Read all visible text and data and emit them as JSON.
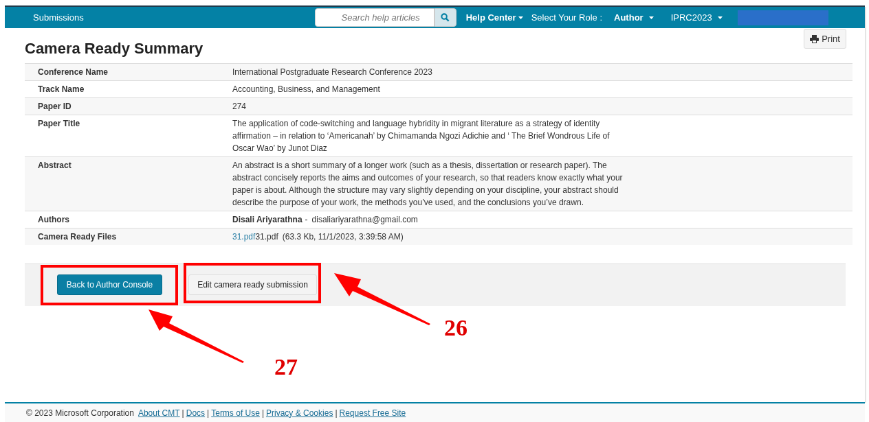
{
  "navbar": {
    "brand": "Submissions",
    "search": {
      "placeholder": "Search help articles"
    },
    "help": "Help Center",
    "role_label": "Select Your Role :",
    "role": "Author",
    "conference": "IPRC2023"
  },
  "page": {
    "title": "Camera Ready Summary",
    "print": "Print"
  },
  "rows": [
    {
      "kind": "text",
      "label": "Conference Name",
      "value": "International Postgraduate Research Conference 2023"
    },
    {
      "kind": "text",
      "label": "Track Name",
      "value": "Accounting, Business, and Management"
    },
    {
      "kind": "text",
      "label": "Paper ID",
      "value": "274"
    },
    {
      "kind": "text",
      "label": "Paper Title",
      "value": "The application of code-switching and language hybridity in migrant literature as a strategy of identity affirmation – in relation to ‘Americanah’ by Chimamanda Ngozi Adichie and ‘ The Brief Wondrous Life of Oscar Wao’ by Junot Diaz"
    },
    {
      "kind": "text",
      "label": "Abstract",
      "value": "An abstract is a short summary of a longer work (such as a thesis, dissertation or research paper). The abstract concisely reports the aims and outcomes of your research, so that readers know exactly what your paper is about. Although the structure may vary slightly depending on your discipline, your abstract should describe the purpose of your work, the methods you’ve used, and the conclusions you’ve drawn."
    },
    {
      "kind": "author",
      "label": "Authors",
      "name": "Disali Ariyarathna",
      "separator": "-",
      "email": "disaliariyarathna@gmail.com"
    },
    {
      "kind": "file",
      "label": "Camera Ready Files",
      "link": "31.pdf",
      "filename": "31.pdf",
      "details": "(63.3 Kb, 11/1/2023, 3:39:58 AM)"
    }
  ],
  "buttons": [
    {
      "kind": "primary",
      "label": "Back to Author Console"
    },
    {
      "kind": "default",
      "label": "Edit camera ready submission"
    }
  ],
  "annotations": [
    "27",
    "26"
  ],
  "footer": {
    "copyright": "© 2023 Microsoft Corporation",
    "separator": "|",
    "links": [
      "About CMT",
      "Docs",
      "Terms of Use",
      "Privacy & Cookies",
      "Request Free Site"
    ]
  }
}
